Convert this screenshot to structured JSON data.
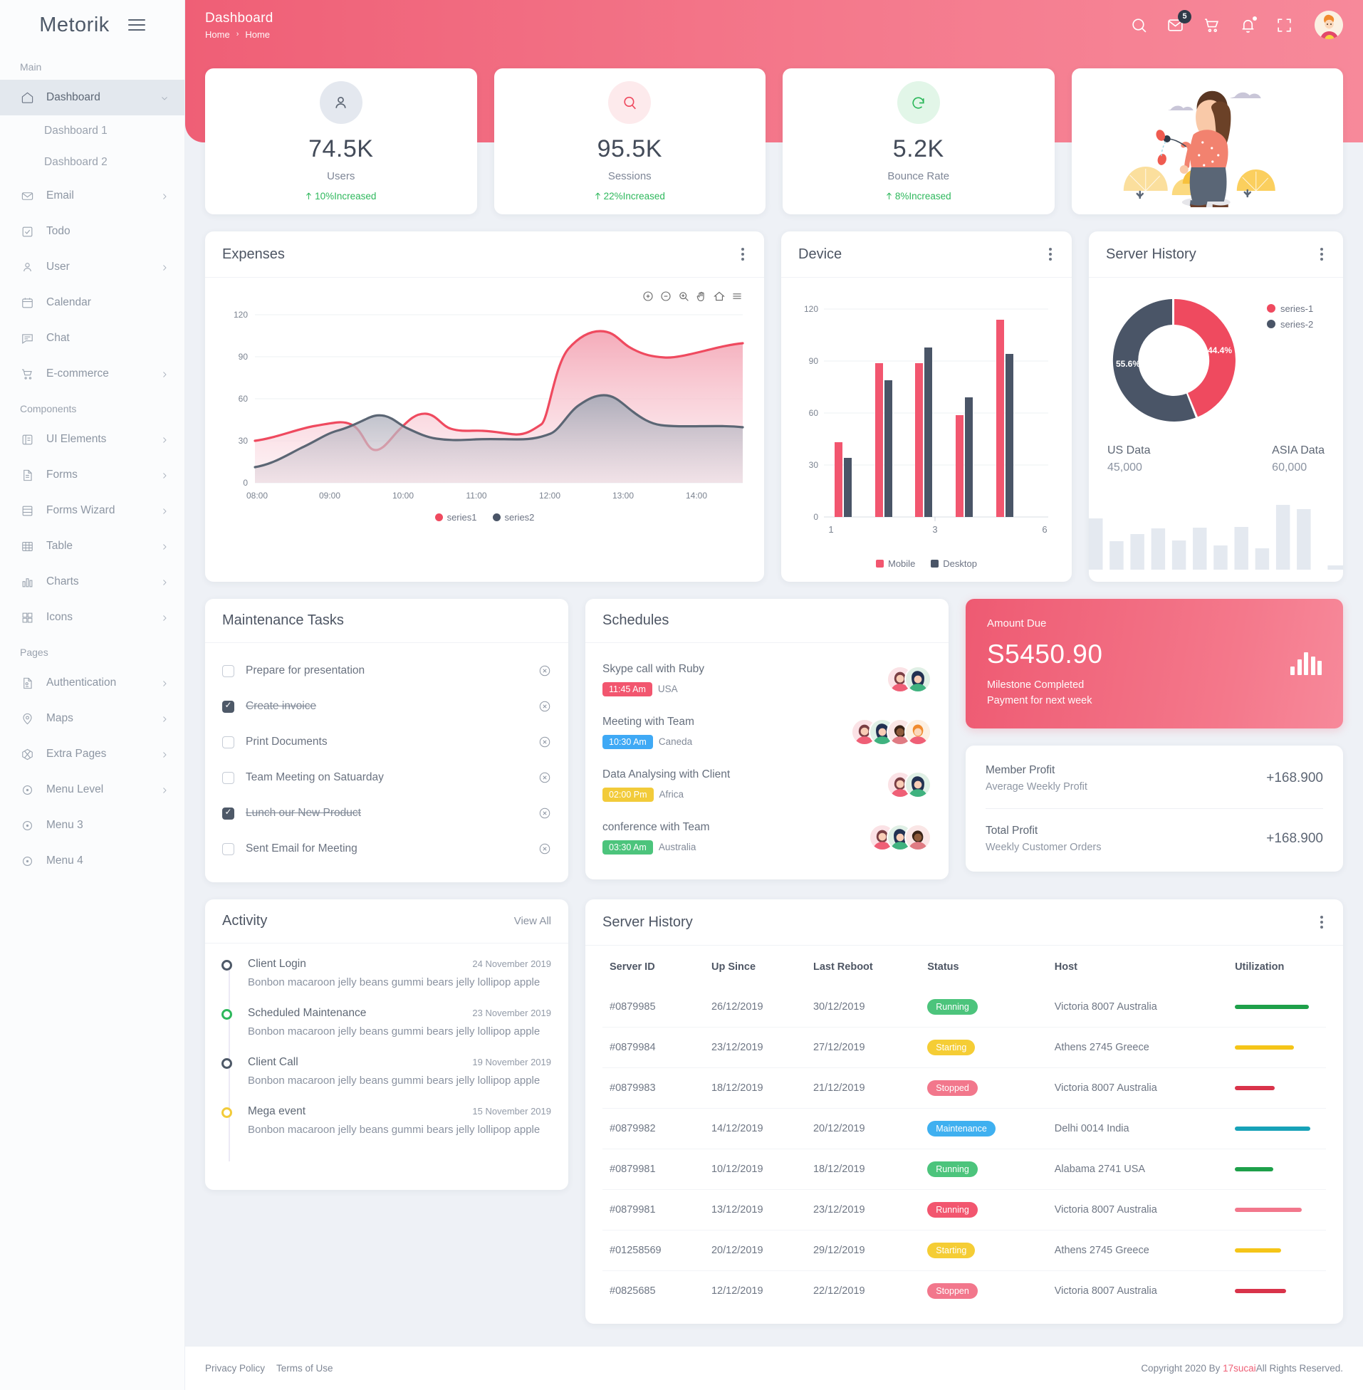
{
  "brand": {
    "name": "Metorik",
    "menu_icon": "hamburger-icon"
  },
  "sidebar": {
    "sections": [
      {
        "label": "Main",
        "items": [
          {
            "label": "Dashboard",
            "icon": "home-icon",
            "active": true,
            "caret": "chevron-down-icon",
            "children": [
              {
                "label": "Dashboard 1"
              },
              {
                "label": "Dashboard 2"
              }
            ]
          },
          {
            "label": "Email",
            "icon": "mail-icon",
            "caret": "chevron-right-icon"
          },
          {
            "label": "Todo",
            "icon": "check-square-icon"
          },
          {
            "label": "User",
            "icon": "user-icon",
            "caret": "chevron-right-icon"
          },
          {
            "label": "Calendar",
            "icon": "calendar-icon"
          },
          {
            "label": "Chat",
            "icon": "chat-icon"
          },
          {
            "label": "E-commerce",
            "icon": "cart-icon",
            "caret": "chevron-right-icon"
          }
        ]
      },
      {
        "label": "Components",
        "items": [
          {
            "label": "UI Elements",
            "icon": "ui-elements-icon",
            "caret": "chevron-right-icon"
          },
          {
            "label": "Forms",
            "icon": "file-icon",
            "caret": "chevron-right-icon"
          },
          {
            "label": "Forms Wizard",
            "icon": "rows-icon",
            "caret": "chevron-right-icon"
          },
          {
            "label": "Table",
            "icon": "table-icon",
            "caret": "chevron-right-icon"
          },
          {
            "label": "Charts",
            "icon": "bar-chart-icon",
            "caret": "chevron-right-icon"
          },
          {
            "label": "Icons",
            "icon": "grid-icon",
            "caret": "chevron-right-icon"
          }
        ]
      },
      {
        "label": "Pages",
        "items": [
          {
            "label": "Authentication",
            "icon": "auth-file-icon",
            "caret": "chevron-right-icon"
          },
          {
            "label": "Maps",
            "icon": "map-pin-icon",
            "caret": "chevron-right-icon"
          },
          {
            "label": "Extra Pages",
            "icon": "box-icon",
            "caret": "chevron-right-icon"
          },
          {
            "label": "Menu Level",
            "icon": "dot-circle-icon",
            "caret": "chevron-right-icon"
          },
          {
            "label": "Menu 3",
            "icon": "dot-circle-icon"
          },
          {
            "label": "Menu 4",
            "icon": "dot-circle-icon"
          }
        ]
      }
    ]
  },
  "topbar": {
    "title": "Dashboard",
    "breadcrumb": [
      "Home",
      "Home"
    ],
    "separator": "›",
    "icons": [
      {
        "name": "search-icon"
      },
      {
        "name": "mail-icon",
        "badge": "5"
      },
      {
        "name": "cart-icon"
      },
      {
        "name": "bell-icon",
        "dot": true
      },
      {
        "name": "fullscreen-icon"
      }
    ],
    "avatar": "user-avatar"
  },
  "stats": [
    {
      "icon": "user-icon",
      "icon_bg": "#e4e8ef",
      "icon_color": "#5b6472",
      "value": "74.5K",
      "label": "Users",
      "change": "10%Increased",
      "change_color": "#2eb85c"
    },
    {
      "icon": "search-icon",
      "icon_bg": "#fdeaec",
      "icon_color": "#ef4a5f",
      "value": "95.5K",
      "label": "Sessions",
      "change": "22%Increased",
      "change_color": "#2eb85c"
    },
    {
      "icon": "refresh-icon",
      "icon_bg": "#e2f6e8",
      "icon_color": "#2eb85c",
      "value": "5.2K",
      "label": "Bounce Rate",
      "change": "8%Increased",
      "change_color": "#2eb85c"
    }
  ],
  "illustration": {
    "name": "woman-with-balloons-illustration"
  },
  "expenses": {
    "title": "Expenses",
    "toolbar_icons": [
      "zoom-in-icon",
      "zoom-out-icon",
      "selection-zoom-icon",
      "pan-icon",
      "reset-icon",
      "menu-icon"
    ]
  },
  "device": {
    "title": "Device"
  },
  "server_history_chart": {
    "title": "Server History",
    "legend": [
      {
        "label": "series-1",
        "color": "#ef4a5f"
      },
      {
        "label": "series-2",
        "color": "#4a5567"
      }
    ],
    "slice_labels": [
      "44.4%",
      "55.6%"
    ],
    "footers": [
      {
        "label": "US Data",
        "value": "45,000"
      },
      {
        "label": "ASIA Data",
        "value": "60,000"
      }
    ]
  },
  "maintenance": {
    "title": "Maintenance Tasks",
    "tasks": [
      {
        "label": "Prepare for presentation",
        "done": false
      },
      {
        "label": "Create invoice",
        "done": true
      },
      {
        "label": "Print Documents",
        "done": false
      },
      {
        "label": "Team Meeting on Satuarday",
        "done": false
      },
      {
        "label": "Lunch our New Product",
        "done": true
      },
      {
        "label": "Sent Email for Meeting",
        "done": false
      }
    ],
    "delete_icon": "close-circle-icon"
  },
  "schedules": {
    "title": "Schedules",
    "items": [
      {
        "name": "Skype call with Ruby",
        "time": "11:45 Am",
        "place": "USA",
        "pill_color": "#f2566f",
        "avatars": 2
      },
      {
        "name": "Meeting with Team",
        "time": "10:30 Am",
        "place": "Caneda",
        "pill_color": "#3fa9f5",
        "avatars": 4
      },
      {
        "name": "Data Analysing with Client",
        "time": "02:00 Pm",
        "place": "Africa",
        "pill_color": "#f2cb3a",
        "avatars": 2
      },
      {
        "name": "conference with Team",
        "time": "03:30 Am",
        "place": "Australia",
        "pill_color": "#4cc47c",
        "avatars": 3
      }
    ]
  },
  "amount_due": {
    "label": "Amount Due",
    "value": "S5450.90",
    "sub_line1": "Milestone Completed",
    "sub_line2": "Payment for next week",
    "icon": "bar-chart-icon"
  },
  "profits": [
    {
      "title": "Member Profit",
      "sub": "Average Weekly Profit",
      "value": "+168.900"
    },
    {
      "title": "Total Profit",
      "sub": "Weekly Customer Orders",
      "value": "+168.900"
    }
  ],
  "activity": {
    "title": "Activity",
    "view_all": "View All",
    "items": [
      {
        "title": "Client Login",
        "date": "24 November 2019",
        "desc": "Bonbon macaroon jelly beans gummi bears jelly lollipop apple",
        "dot_color": "#4e5968"
      },
      {
        "title": "Scheduled Maintenance",
        "date": "23 November 2019",
        "desc": "Bonbon macaroon jelly beans gummi bears jelly lollipop apple",
        "dot_color": "#2eb85c"
      },
      {
        "title": "Client Call",
        "date": "19 November 2019",
        "desc": "Bonbon macaroon jelly beans gummi bears jelly lollipop apple",
        "dot_color": "#4e5968"
      },
      {
        "title": "Mega event",
        "date": "15 November 2019",
        "desc": "Bonbon macaroon jelly beans gummi bears jelly lollipop apple",
        "dot_color": "#f2cb3a"
      }
    ]
  },
  "server_table": {
    "title": "Server History",
    "columns": [
      "Server ID",
      "Up Since",
      "Last Reboot",
      "Status",
      "Host",
      "Utilization"
    ],
    "rows": [
      {
        "id": "#0879985",
        "up": "26/12/2019",
        "reboot": "30/12/2019",
        "status": "Running",
        "status_color": "#4cc47c",
        "host": "Victoria 8007 Australia",
        "util": 88,
        "util_color": "#1ea04a"
      },
      {
        "id": "#0879984",
        "up": "23/12/2019",
        "reboot": "27/12/2019",
        "status": "Starting",
        "status_color": "#f5cd35",
        "host": "Athens 2745 Greece",
        "util": 70,
        "util_color": "#f5c518"
      },
      {
        "id": "#0879983",
        "up": "18/12/2019",
        "reboot": "21/12/2019",
        "status": "Stopped",
        "status_color": "#f2778c",
        "host": "Victoria 8007 Australia",
        "util": 47,
        "util_color": "#d9334a"
      },
      {
        "id": "#0879982",
        "up": "14/12/2019",
        "reboot": "20/12/2019",
        "status": "Maintenance",
        "status_color": "#3fb0f0",
        "host": "Delhi 0014 India",
        "util": 90,
        "util_color": "#17a2b8"
      },
      {
        "id": "#0879981",
        "up": "10/12/2019",
        "reboot": "18/12/2019",
        "status": "Running",
        "status_color": "#4cc47c",
        "host": "Alabama 2741 USA",
        "util": 46,
        "util_color": "#1ea04a"
      },
      {
        "id": "#0879981",
        "up": "13/12/2019",
        "reboot": "23/12/2019",
        "status": "Running",
        "status_color": "#f2566f",
        "host": "Victoria 8007 Australia",
        "util": 80,
        "util_color": "#f2778c"
      },
      {
        "id": "#01258569",
        "up": "20/12/2019",
        "reboot": "29/12/2019",
        "status": "Starting",
        "status_color": "#f5cd35",
        "host": "Athens 2745 Greece",
        "util": 55,
        "util_color": "#f5c518"
      },
      {
        "id": "#0825685",
        "up": "12/12/2019",
        "reboot": "22/12/2019",
        "status": "Stoppen",
        "status_color": "#f2778c",
        "host": "Victoria 8007 Australia",
        "util": 61,
        "util_color": "#d9334a"
      }
    ]
  },
  "footer": {
    "links": [
      "Privacy Policy",
      "Terms of Use"
    ],
    "copyright_pre": "Copyright 2020 By ",
    "copyright_brand": "17sucai",
    "copyright_post": "All Rights Reserved."
  },
  "chart_data": [
    {
      "type": "area",
      "title": "Expenses",
      "x": [
        "08:00",
        "08:30",
        "09:00",
        "09:30",
        "10:00",
        "10:30",
        "11:00",
        "11:30",
        "12:00",
        "12:30",
        "13:00",
        "13:30",
        "14:00",
        "14:30"
      ],
      "xlabel": "",
      "ylabel": "",
      "ylim": [
        0,
        120
      ],
      "yticks": [
        0,
        30,
        60,
        90,
        120
      ],
      "xticks": [
        "08:00",
        "09:00",
        "10:00",
        "11:00",
        "12:00",
        "13:00",
        "14:00"
      ],
      "grid": true,
      "legend": "bottom",
      "series": [
        {
          "name": "series1",
          "color": "#ef4a5f",
          "values": [
            30,
            33,
            38,
            41,
            36,
            27,
            36,
            50,
            44,
            41,
            85,
            108,
            101,
            99
          ]
        },
        {
          "name": "series2",
          "color": "#4a5567",
          "values": [
            11,
            18,
            30,
            35,
            37,
            45,
            38,
            31,
            33,
            33,
            43,
            52,
            43,
            40
          ]
        }
      ]
    },
    {
      "type": "bar",
      "title": "Device",
      "categories": [
        "1",
        "2",
        "3",
        "4",
        "6"
      ],
      "xticks": [
        "1",
        "3",
        "6"
      ],
      "ylim": [
        0,
        120
      ],
      "yticks": [
        0,
        30,
        60,
        90,
        120
      ],
      "grid": true,
      "legend": "bottom",
      "series": [
        {
          "name": "Mobile",
          "color": "#f2566f",
          "values": [
            43,
            89,
            89,
            59,
            114
          ]
        },
        {
          "name": "Desktop",
          "color": "#4a5567",
          "values": [
            34,
            79,
            98,
            69,
            94
          ]
        }
      ]
    },
    {
      "type": "pie",
      "title": "Server History",
      "labels": [
        "series-1",
        "series-2"
      ],
      "values": [
        44.4,
        55.6
      ],
      "colors": [
        "#ef4a5f",
        "#4a5567"
      ],
      "legend": "right",
      "donut": true
    },
    {
      "type": "bar",
      "title": "Server History Sparkline",
      "categories": [
        "1",
        "2",
        "3",
        "4",
        "5",
        "6",
        "7",
        "8",
        "9",
        "10",
        "11",
        "12"
      ],
      "values": [
        62,
        37,
        45,
        52,
        38,
        53,
        30,
        54,
        26,
        80,
        75,
        2
      ],
      "ylim": [
        0,
        100
      ],
      "grid": false,
      "color": "#e4e9f0"
    }
  ]
}
